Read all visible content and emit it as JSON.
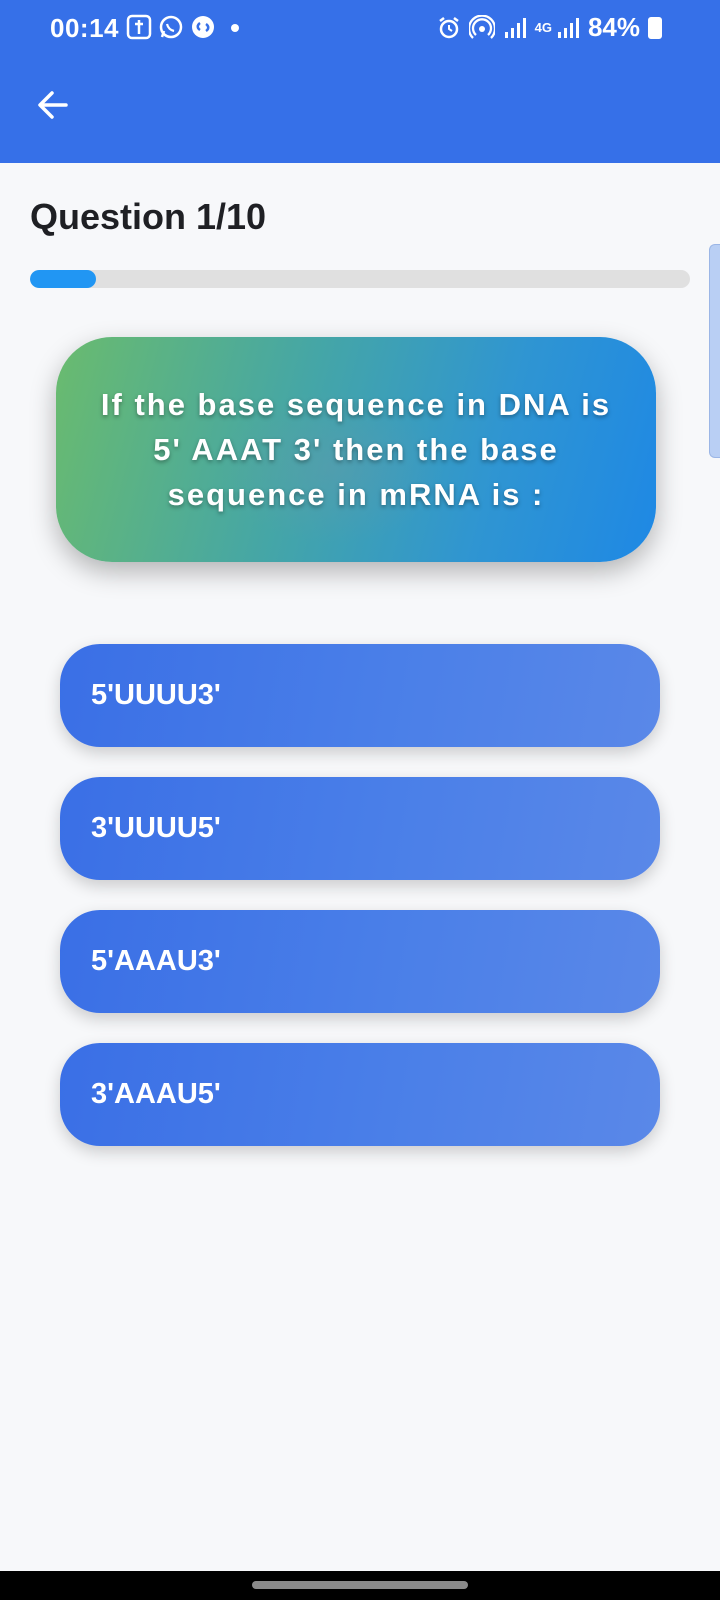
{
  "status_bar": {
    "time": "00:14",
    "battery": "84%",
    "notification_icons": [
      "bible-app-icon",
      "whatsapp-icon",
      "shazam-icon",
      "dot-icon"
    ],
    "system_icons": [
      "alarm-icon",
      "hotspot-icon",
      "signal-icon",
      "4g-signal-icon",
      "battery-charging-icon"
    ],
    "network_label": "4G"
  },
  "app_bar": {
    "back_icon": "arrow-left-icon",
    "background_color": "#3670e8"
  },
  "quiz": {
    "title": "Question 1/10",
    "progress_fraction": 0.1,
    "question": "If the base sequence in DNA is 5' AAAT 3' then the base sequence in mRNA is :",
    "options": [
      {
        "label": "5'UUUU3'"
      },
      {
        "label": "3'UUUU5'"
      },
      {
        "label": "5'AAAU3'"
      },
      {
        "label": "3'AAAU5'"
      }
    ]
  },
  "colors": {
    "accent": "#3670e8",
    "progress": "#2196f3",
    "card_gradient_start": "#6abb6e",
    "card_gradient_end": "#1e88e5"
  }
}
